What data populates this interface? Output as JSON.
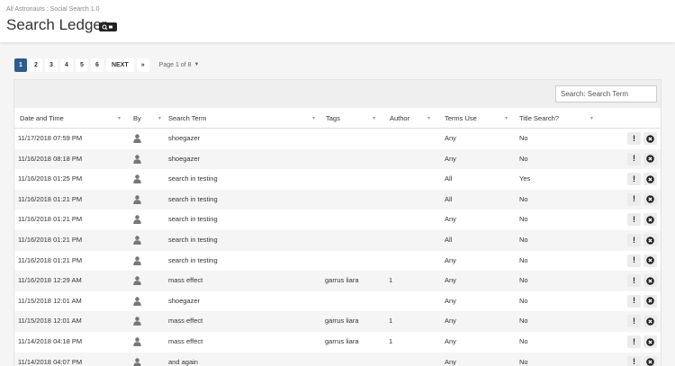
{
  "breadcrumb": "All Astronauts : Social Search 1.0",
  "page_title": "Search Ledger",
  "pager": {
    "pages": [
      "1",
      "2",
      "3",
      "4",
      "5",
      "6"
    ],
    "active": "1",
    "next_label": "NEXT",
    "last_label": "»",
    "info": "Page 1 of 8"
  },
  "search": {
    "placeholder": "Search: Search Term"
  },
  "columns": [
    "Date and Time",
    "By",
    "Search Term",
    "Tags",
    "Author",
    "Terms Use",
    "Title Search?"
  ],
  "rows": [
    {
      "date": "11/17/2018 07:59 PM",
      "term": "shoegazer",
      "tags": "",
      "author": "",
      "terms_use": "Any",
      "title_search": "No"
    },
    {
      "date": "11/16/2018 08:18 PM",
      "term": "shoegazer",
      "tags": "",
      "author": "",
      "terms_use": "Any",
      "title_search": "No"
    },
    {
      "date": "11/16/2018 01:25 PM",
      "term": "search in testing",
      "tags": "",
      "author": "",
      "terms_use": "All",
      "title_search": "Yes"
    },
    {
      "date": "11/16/2018 01:21 PM",
      "term": "search in testing",
      "tags": "",
      "author": "",
      "terms_use": "All",
      "title_search": "No"
    },
    {
      "date": "11/16/2018 01:21 PM",
      "term": "search in testing",
      "tags": "",
      "author": "",
      "terms_use": "Any",
      "title_search": "No"
    },
    {
      "date": "11/16/2018 01:21 PM",
      "term": "search in testing",
      "tags": "",
      "author": "",
      "terms_use": "All",
      "title_search": "No"
    },
    {
      "date": "11/16/2018 01:21 PM",
      "term": "search in testing",
      "tags": "",
      "author": "",
      "terms_use": "Any",
      "title_search": "No"
    },
    {
      "date": "11/16/2018 12:29 AM",
      "term": "mass effect",
      "tags": "garrus liara",
      "author": "1",
      "terms_use": "Any",
      "title_search": "No"
    },
    {
      "date": "11/15/2018 12:01 AM",
      "term": "shoegazer",
      "tags": "",
      "author": "",
      "terms_use": "Any",
      "title_search": "No"
    },
    {
      "date": "11/15/2018 12:01 AM",
      "term": "mass effect",
      "tags": "garrus liara",
      "author": "1",
      "terms_use": "Any",
      "title_search": "No"
    },
    {
      "date": "11/14/2018 04:18 PM",
      "term": "mass effect",
      "tags": "garrus liara",
      "author": "1",
      "terms_use": "Any",
      "title_search": "No"
    },
    {
      "date": "11/14/2018 04:07 PM",
      "term": "and again",
      "tags": "",
      "author": "",
      "terms_use": "Any",
      "title_search": "No"
    }
  ],
  "icons": {
    "by": "user-icon",
    "detail": "exclamation-icon",
    "delete": "close-circle-icon",
    "badge": "search-icon"
  },
  "colors": {
    "accent": "#2c5c8c"
  }
}
